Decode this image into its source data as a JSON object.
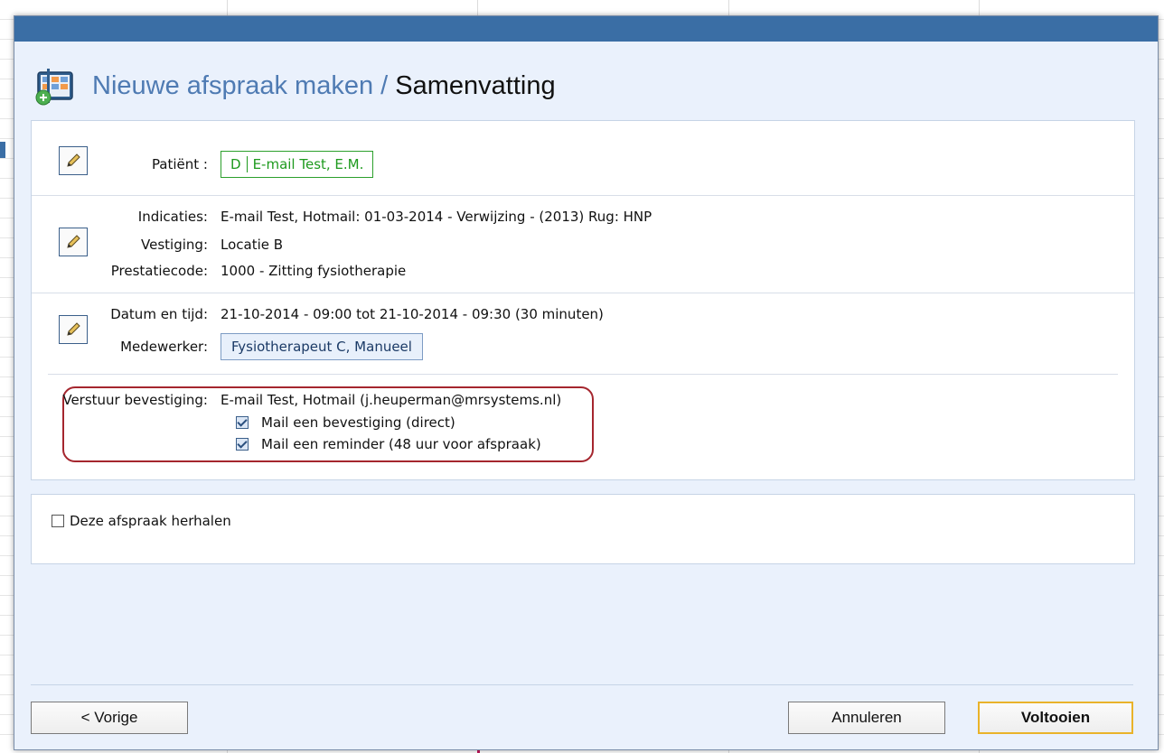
{
  "header": {
    "title_main": "Nieuwe afspraak maken",
    "title_separator": " / ",
    "title_sub": "Samenvatting",
    "icon": "calendar-add-icon"
  },
  "patient": {
    "label": "Patiënt :",
    "tag_prefix": "D",
    "tag_name": "E-mail Test, E.M."
  },
  "details": {
    "indicaties_label": "Indicaties:",
    "indicaties_value": "E-mail Test, Hotmail: 01-03-2014 - Verwijzing - (2013) Rug: HNP",
    "vestiging_label": "Vestiging:",
    "vestiging_value": "Locatie B",
    "prestatiecode_label": "Prestatiecode:",
    "prestatiecode_value": "1000 - Zitting fysiotherapie"
  },
  "appointment": {
    "datetime_label": "Datum en tijd:",
    "datetime_value": "21-10-2014 - 09:00 tot 21-10-2014 - 09:30 (30 minuten)",
    "employee_label": "Medewerker:",
    "employee_value": "Fysiotherapeut C, Manueel"
  },
  "confirmation": {
    "label": "Verstuur bevestiging:",
    "recipient": "E-mail Test, Hotmail (j.heuperman@mrsystems.nl)",
    "option_direct": "Mail een bevestiging (direct)",
    "option_direct_checked": true,
    "option_reminder": "Mail een reminder (48 uur voor afspraak)",
    "option_reminder_checked": true
  },
  "repeat": {
    "label": "Deze afspraak herhalen",
    "checked": false
  },
  "footer": {
    "prev_label": "< Vorige",
    "cancel_label": "Annuleren",
    "finish_label": "Voltooien"
  },
  "colors": {
    "titlebar": "#3a6ea5",
    "title_accent": "#4f7bb3",
    "patient_green": "#1e9a1e",
    "highlight_red": "#a5262e",
    "finish_border": "#e9b32a"
  }
}
